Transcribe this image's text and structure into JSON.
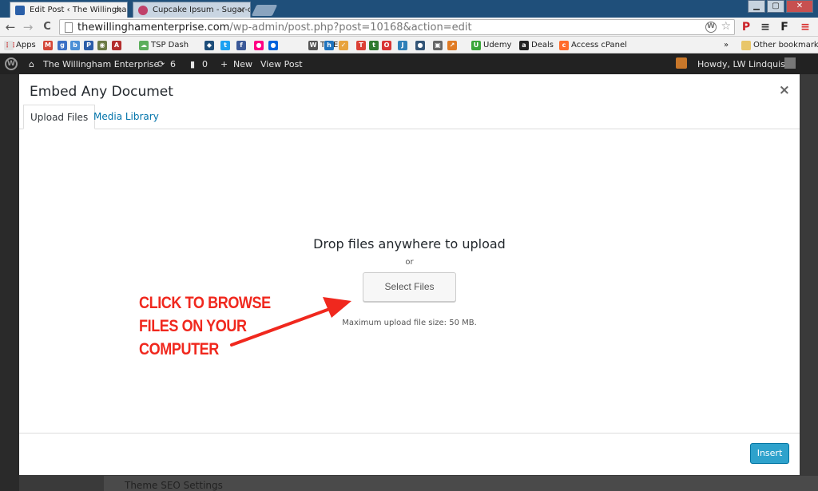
{
  "browser": {
    "tabs": [
      {
        "title": "Edit Post ‹ The Willingham",
        "close": "×",
        "active": true,
        "favicon_color": "#2a5fa8"
      },
      {
        "title": "Cupcake Ipsum - Sugar-co",
        "close": "×",
        "active": false,
        "favicon_color": "#c0416a"
      }
    ],
    "window_buttons": {
      "minimize": "▁",
      "maximize": "▢",
      "close": "✕"
    },
    "url_host": "thewillinghamenterprise.com",
    "url_rest": "/wp-admin/post.php?post=10168&action=edit",
    "icons": {
      "back": "←",
      "forward": "→",
      "reload": "C",
      "star": "☆",
      "wp": "W"
    }
  },
  "extensions": [
    {
      "name": "pinterest-icon",
      "glyph": "P",
      "color": "#cb2027"
    },
    {
      "name": "buffer-icon",
      "glyph": "≡",
      "color": "#333333"
    },
    {
      "name": "feedly-icon",
      "glyph": "F",
      "color": "#222222"
    },
    {
      "name": "menu-icon",
      "glyph": "≡",
      "color": "#d9302e"
    }
  ],
  "bookmarks": {
    "apps": "Apps",
    "items": [
      {
        "label": "",
        "icon": "gmail-icon",
        "glyph": "M",
        "color": "#d44638"
      },
      {
        "label": "",
        "icon": "google-plus-icon",
        "glyph": "g",
        "color": "#3b6fc5"
      },
      {
        "label": "",
        "icon": "bing-icon",
        "glyph": "b",
        "color": "#4b8fd6"
      },
      {
        "label": "",
        "icon": "pay-icon",
        "glyph": "P",
        "color": "#2b5da8"
      },
      {
        "label": "",
        "icon": "camera-icon",
        "glyph": "◉",
        "color": "#6a7a45"
      },
      {
        "label": "",
        "icon": "pdf-icon",
        "glyph": "A",
        "color": "#b32d2d"
      },
      {
        "label": "TSP Dash",
        "icon": "cloud-icon",
        "glyph": "☁",
        "color": "#5cae5c"
      },
      {
        "label": "",
        "icon": "shield-icon",
        "glyph": "◆",
        "color": "#1d4d7a"
      },
      {
        "label": "",
        "icon": "twitter-icon",
        "glyph": "t",
        "color": "#1da1f2"
      },
      {
        "label": "",
        "icon": "facebook-icon",
        "glyph": "f",
        "color": "#3b5998"
      },
      {
        "label": "",
        "icon": "flickr-icon",
        "glyph": "●",
        "color": "#ff0084"
      },
      {
        "label": "",
        "icon": "flickr-blue-icon",
        "glyph": "●",
        "color": "#0063dc"
      },
      {
        "label": "TWE",
        "icon": "w-icon",
        "glyph": "W",
        "color": "#555555"
      },
      {
        "label": "",
        "icon": "h-icon",
        "glyph": "h",
        "color": "#1e73be"
      },
      {
        "label": "",
        "icon": "check-icon",
        "glyph": "✓",
        "color": "#e8a33d"
      },
      {
        "label": "",
        "icon": "todoist-icon",
        "glyph": "T",
        "color": "#db4035"
      },
      {
        "label": "",
        "icon": "pinboard-icon",
        "glyph": "t",
        "color": "#2f7a2f"
      },
      {
        "label": "",
        "icon": "opera-icon",
        "glyph": "O",
        "color": "#d93434"
      },
      {
        "label": "",
        "icon": "jira-icon",
        "glyph": "J",
        "color": "#2e7fb8"
      },
      {
        "label": "",
        "icon": "ghost-icon",
        "glyph": "●",
        "color": "#335577"
      },
      {
        "label": "",
        "icon": "photo-icon",
        "glyph": "▣",
        "color": "#666666"
      },
      {
        "label": "",
        "icon": "chart-icon",
        "glyph": "↗",
        "color": "#e07b24"
      },
      {
        "label": "Udemy",
        "icon": "udemy-icon",
        "glyph": "U",
        "color": "#3aa63a"
      },
      {
        "label": "Deals",
        "icon": "amazon-icon",
        "glyph": "a",
        "color": "#222222"
      },
      {
        "label": "Access cPanel",
        "icon": "cpanel-icon",
        "glyph": "c",
        "color": "#ff6c2c"
      }
    ],
    "overflow": "»",
    "other": "Other bookmarks"
  },
  "adminbar": {
    "site_name": "The Willingham Enterprise",
    "updates": "6",
    "comments": "0",
    "new": "New",
    "view_post": "View Post",
    "howdy": "Howdy, LW Lindquist"
  },
  "background": {
    "visible_text": "Theme SEO Settings"
  },
  "modal": {
    "title": "Embed Any Documet",
    "close": "×",
    "tabs": {
      "upload": "Upload Files",
      "library": "Media Library"
    },
    "drop_title": "Drop files anywhere to upload",
    "or": "or",
    "select_button": "Select Files",
    "max_size": "Maximum upload file size: 50 MB.",
    "insert": "Insert"
  },
  "annotation": {
    "lines": [
      "CLICK TO BROWSE",
      "FILES ON YOUR",
      "COMPUTER"
    ],
    "color": "#f0281e"
  }
}
